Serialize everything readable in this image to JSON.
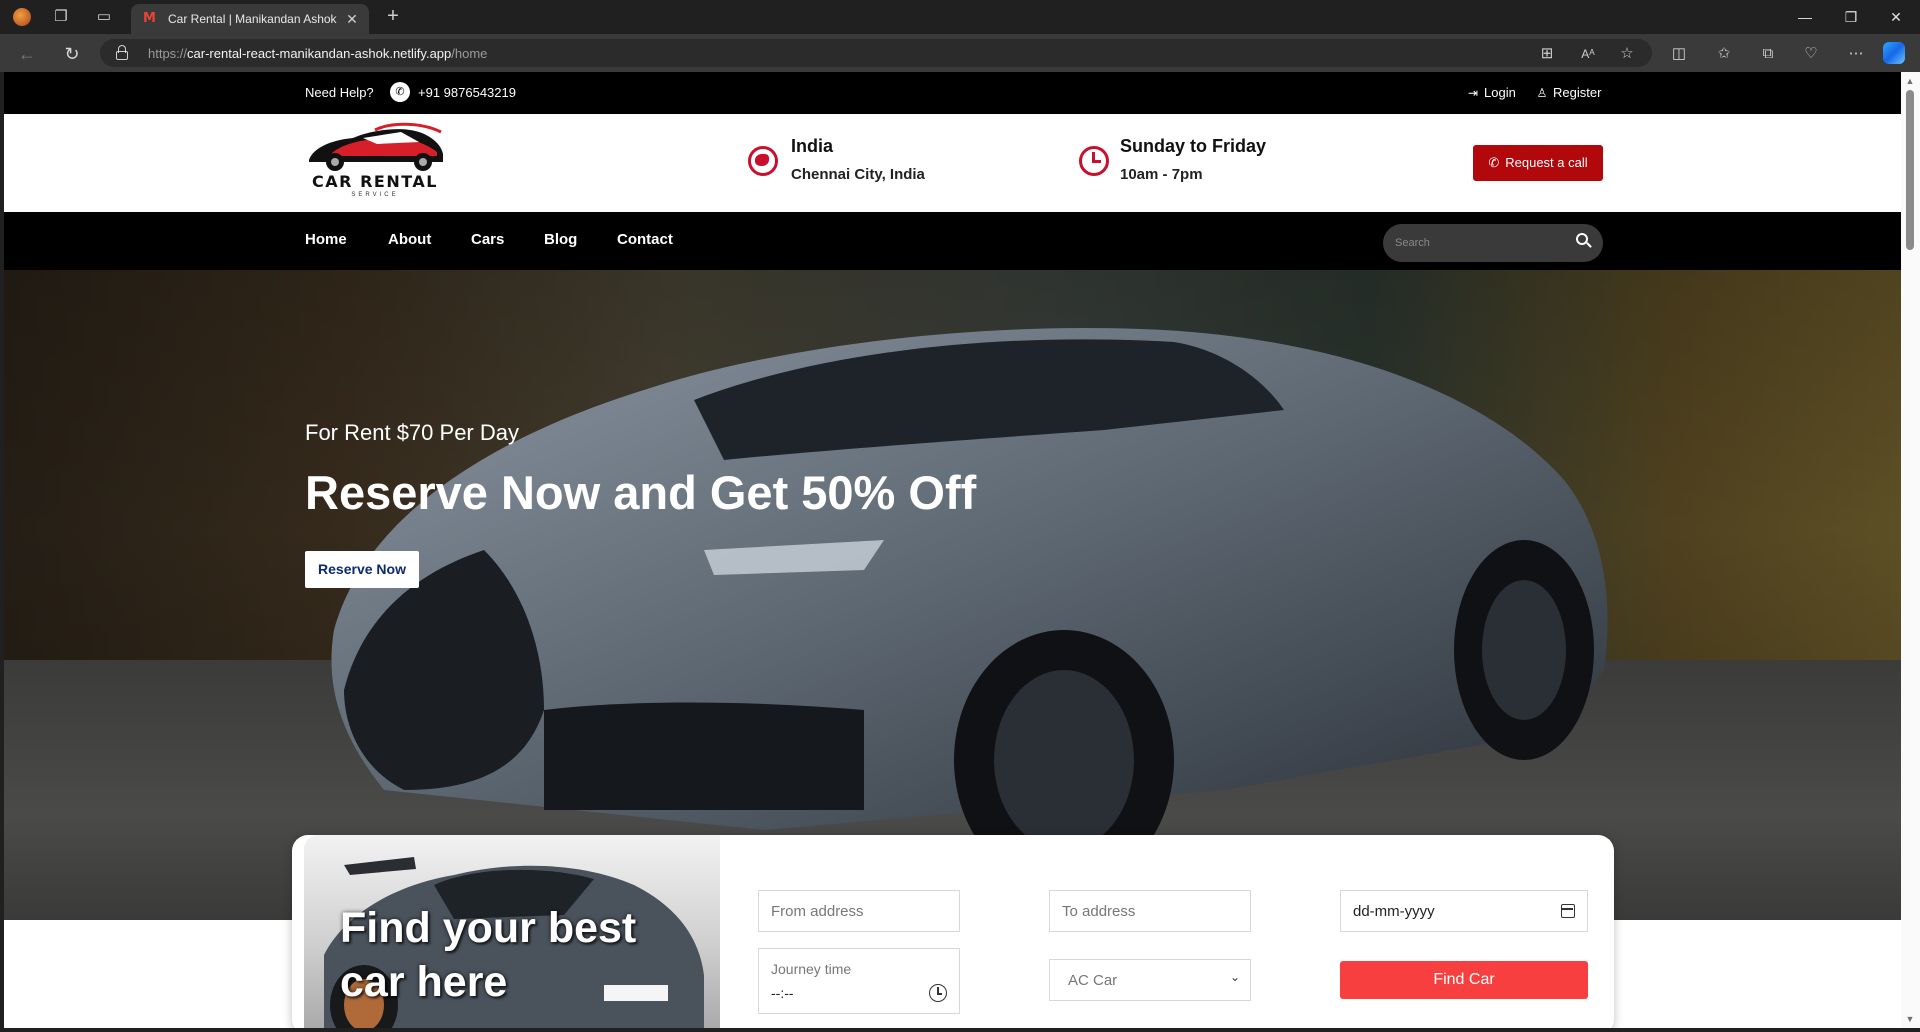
{
  "browser": {
    "tab_title": "Car Rental | Manikandan Ashok",
    "url_scheme": "https://",
    "url_host": "car-rental-react-manikandan-ashok.netlify.app",
    "url_path": "/home"
  },
  "topbar": {
    "need_help": "Need Help?",
    "phone": "+91 9876543219",
    "login": "Login",
    "register": "Register"
  },
  "header": {
    "logo_text": "CAR RENTAL",
    "logo_sub": "SERVICE",
    "location_title": "India",
    "location_sub": "Chennai City, India",
    "hours_title": "Sunday to Friday",
    "hours_sub": "10am - 7pm",
    "request_call": "Request a call"
  },
  "nav": {
    "items": [
      "Home",
      "About",
      "Cars",
      "Blog",
      "Contact"
    ],
    "search_placeholder": "Search"
  },
  "hero": {
    "subtitle": "For Rent $70 Per Day",
    "title": "Reserve Now and Get 50% Off",
    "cta": "Reserve Now"
  },
  "booking": {
    "image_title": "Find your best car here",
    "from_placeholder": "From address",
    "to_placeholder": "To address",
    "date_value": "dd-mm-yyyy",
    "journey_label": "Journey time",
    "journey_value": "--:--",
    "car_type": "AC Car",
    "find_button": "Find Car"
  },
  "colors": {
    "brand_red": "#b0080b",
    "find_button": "#f83f3f",
    "icon_red": "#c8102e"
  }
}
